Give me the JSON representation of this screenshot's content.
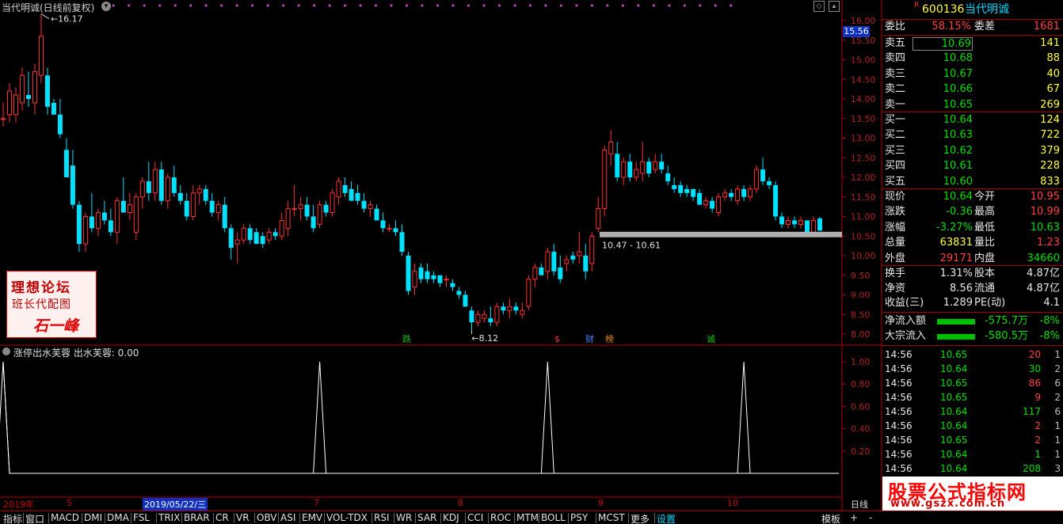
{
  "header": {
    "title": "当代明诚(日线前复权)",
    "cursor_price": "15.56",
    "high_label": "16.17",
    "low_label": "8.12",
    "band_label": "10.47 - 10.61"
  },
  "y_ticks": [
    "16.00",
    "15.50",
    "15.00",
    "14.50",
    "14.00",
    "13.50",
    "13.00",
    "12.50",
    "12.00",
    "11.50",
    "11.00",
    "10.50",
    "10.00",
    "9.50",
    "9.00",
    "8.50",
    "8.00"
  ],
  "sub_ticks": [
    "1.00",
    "0.80",
    "0.60",
    "0.40",
    "0.20"
  ],
  "events": [
    {
      "label": "跌",
      "color": "#00c000"
    },
    {
      "label": "$",
      "color": "#ff3030"
    },
    {
      "label": "财",
      "color": "#4080ff"
    },
    {
      "label": "榜",
      "color": "#e08000"
    },
    {
      "label": "诚",
      "color": "#00c000"
    }
  ],
  "stamp": {
    "line1": "理想论坛",
    "line2": "班长代配图",
    "line3": "石一峰"
  },
  "indicator": {
    "title": "涨停出水芙蓉  出水芙蓉: 0.00"
  },
  "x_dates": {
    "year": "2019年",
    "m5": "5",
    "highlight": "2019/05/22/三",
    "m7": "7",
    "m8": "8",
    "m9": "9",
    "m10": "10",
    "period": "日线"
  },
  "chart_data": {
    "type": "candlestick",
    "title": "当代明诚(日线前复权)",
    "ylim": [
      7.8,
      16.2
    ],
    "candles": [
      {
        "o": 13.5,
        "h": 13.9,
        "l": 13.3,
        "c": 13.5
      },
      {
        "o": 13.6,
        "h": 14.4,
        "l": 13.4,
        "c": 14.2
      },
      {
        "o": 13.6,
        "h": 14.3,
        "l": 13.4,
        "c": 14.1
      },
      {
        "o": 13.9,
        "h": 14.8,
        "l": 13.7,
        "c": 14.6
      },
      {
        "o": 14.1,
        "h": 14.7,
        "l": 13.8,
        "c": 14.0
      },
      {
        "o": 13.9,
        "h": 14.9,
        "l": 13.6,
        "c": 14.7
      },
      {
        "o": 14.6,
        "h": 16.17,
        "l": 14.4,
        "c": 15.6
      },
      {
        "o": 14.6,
        "h": 14.8,
        "l": 13.6,
        "c": 13.8
      },
      {
        "o": 13.9,
        "h": 14.0,
        "l": 13.6,
        "c": 13.6
      },
      {
        "o": 13.6,
        "h": 14.0,
        "l": 13.0,
        "c": 13.1
      },
      {
        "o": 12.7,
        "h": 13.0,
        "l": 12.0,
        "c": 12.0
      },
      {
        "o": 12.3,
        "h": 12.7,
        "l": 11.2,
        "c": 11.3
      },
      {
        "o": 11.3,
        "h": 11.4,
        "l": 10.1,
        "c": 10.3
      },
      {
        "o": 10.3,
        "h": 11.1,
        "l": 10.1,
        "c": 11.0
      },
      {
        "o": 11.0,
        "h": 11.6,
        "l": 10.6,
        "c": 10.7
      },
      {
        "o": 10.7,
        "h": 11.2,
        "l": 10.5,
        "c": 11.1
      },
      {
        "o": 11.1,
        "h": 11.4,
        "l": 10.8,
        "c": 10.9
      },
      {
        "o": 10.9,
        "h": 11.2,
        "l": 10.5,
        "c": 10.6
      },
      {
        "o": 10.6,
        "h": 11.5,
        "l": 10.3,
        "c": 11.4
      },
      {
        "o": 11.4,
        "h": 12.0,
        "l": 11.1,
        "c": 11.1
      },
      {
        "o": 11.1,
        "h": 11.6,
        "l": 10.9,
        "c": 11.3
      },
      {
        "o": 10.6,
        "h": 11.6,
        "l": 10.4,
        "c": 11.5
      },
      {
        "o": 11.5,
        "h": 12.0,
        "l": 11.2,
        "c": 11.9
      },
      {
        "o": 11.9,
        "h": 12.4,
        "l": 11.4,
        "c": 11.6
      },
      {
        "o": 11.6,
        "h": 12.4,
        "l": 11.4,
        "c": 12.2
      },
      {
        "o": 12.2,
        "h": 12.4,
        "l": 11.3,
        "c": 11.4
      },
      {
        "o": 11.4,
        "h": 12.1,
        "l": 11.2,
        "c": 12.0
      },
      {
        "o": 12.0,
        "h": 12.3,
        "l": 11.5,
        "c": 11.6
      },
      {
        "o": 11.6,
        "h": 11.8,
        "l": 11.3,
        "c": 11.4
      },
      {
        "o": 11.4,
        "h": 11.6,
        "l": 10.9,
        "c": 11.0
      },
      {
        "o": 11.0,
        "h": 11.8,
        "l": 10.9,
        "c": 11.6
      },
      {
        "o": 11.6,
        "h": 11.8,
        "l": 11.3,
        "c": 11.7
      },
      {
        "o": 11.7,
        "h": 11.8,
        "l": 11.3,
        "c": 11.4
      },
      {
        "o": 11.4,
        "h": 11.6,
        "l": 11.0,
        "c": 11.1
      },
      {
        "o": 11.1,
        "h": 11.4,
        "l": 10.9,
        "c": 11.3
      },
      {
        "o": 11.3,
        "h": 11.5,
        "l": 10.6,
        "c": 10.7
      },
      {
        "o": 10.7,
        "h": 10.8,
        "l": 9.9,
        "c": 10.2
      },
      {
        "o": 10.3,
        "h": 10.6,
        "l": 9.8,
        "c": 10.4
      },
      {
        "o": 10.4,
        "h": 10.8,
        "l": 10.3,
        "c": 10.7
      },
      {
        "o": 10.7,
        "h": 10.8,
        "l": 10.3,
        "c": 10.4
      },
      {
        "o": 10.6,
        "h": 10.7,
        "l": 10.3,
        "c": 10.3
      },
      {
        "o": 10.5,
        "h": 10.6,
        "l": 10.2,
        "c": 10.3
      },
      {
        "o": 10.4,
        "h": 10.7,
        "l": 10.3,
        "c": 10.6
      },
      {
        "o": 10.6,
        "h": 10.7,
        "l": 10.4,
        "c": 10.5
      },
      {
        "o": 10.5,
        "h": 11.1,
        "l": 10.4,
        "c": 10.9
      },
      {
        "o": 10.7,
        "h": 11.4,
        "l": 10.5,
        "c": 11.2
      },
      {
        "o": 11.2,
        "h": 11.8,
        "l": 11.0,
        "c": 11.2
      },
      {
        "o": 11.2,
        "h": 11.5,
        "l": 10.9,
        "c": 11.3
      },
      {
        "o": 11.3,
        "h": 11.5,
        "l": 10.9,
        "c": 11.0
      },
      {
        "o": 11.0,
        "h": 11.3,
        "l": 10.6,
        "c": 10.7
      },
      {
        "o": 10.8,
        "h": 11.4,
        "l": 10.7,
        "c": 11.3
      },
      {
        "o": 11.3,
        "h": 11.4,
        "l": 11.0,
        "c": 11.1
      },
      {
        "o": 11.1,
        "h": 11.7,
        "l": 11.0,
        "c": 11.6
      },
      {
        "o": 11.5,
        "h": 12.0,
        "l": 11.3,
        "c": 11.9
      },
      {
        "o": 11.8,
        "h": 12.0,
        "l": 11.5,
        "c": 11.6
      },
      {
        "o": 11.7,
        "h": 11.9,
        "l": 11.4,
        "c": 11.4
      },
      {
        "o": 11.6,
        "h": 11.8,
        "l": 11.3,
        "c": 11.4
      },
      {
        "o": 11.4,
        "h": 11.6,
        "l": 11.1,
        "c": 11.2
      },
      {
        "o": 11.2,
        "h": 11.4,
        "l": 11.0,
        "c": 11.3
      },
      {
        "o": 11.2,
        "h": 11.3,
        "l": 10.9,
        "c": 10.9
      },
      {
        "o": 10.9,
        "h": 11.1,
        "l": 10.6,
        "c": 10.7
      },
      {
        "o": 10.7,
        "h": 10.8,
        "l": 10.6,
        "c": 10.7
      },
      {
        "o": 10.7,
        "h": 10.9,
        "l": 10.5,
        "c": 10.6
      },
      {
        "o": 10.6,
        "h": 10.8,
        "l": 10.0,
        "c": 10.1
      },
      {
        "o": 10.0,
        "h": 10.1,
        "l": 9.0,
        "c": 9.1
      },
      {
        "o": 9.2,
        "h": 9.8,
        "l": 9.0,
        "c": 9.6
      },
      {
        "o": 9.7,
        "h": 9.8,
        "l": 9.3,
        "c": 9.4
      },
      {
        "o": 9.6,
        "h": 9.8,
        "l": 9.3,
        "c": 9.4
      },
      {
        "o": 9.5,
        "h": 9.6,
        "l": 9.3,
        "c": 9.4
      },
      {
        "o": 9.5,
        "h": 9.5,
        "l": 9.2,
        "c": 9.3
      },
      {
        "o": 9.4,
        "h": 9.5,
        "l": 9.2,
        "c": 9.4
      },
      {
        "o": 9.3,
        "h": 9.4,
        "l": 9.1,
        "c": 9.2
      },
      {
        "o": 9.1,
        "h": 9.2,
        "l": 8.9,
        "c": 9.0
      },
      {
        "o": 9.0,
        "h": 9.1,
        "l": 8.7,
        "c": 8.7
      },
      {
        "o": 8.6,
        "h": 8.7,
        "l": 8.12,
        "c": 8.3
      },
      {
        "o": 8.3,
        "h": 8.6,
        "l": 8.2,
        "c": 8.5
      },
      {
        "o": 8.4,
        "h": 8.6,
        "l": 8.3,
        "c": 8.5
      },
      {
        "o": 8.4,
        "h": 8.7,
        "l": 8.2,
        "c": 8.3
      },
      {
        "o": 8.3,
        "h": 8.8,
        "l": 8.2,
        "c": 8.7
      },
      {
        "o": 8.7,
        "h": 8.8,
        "l": 8.5,
        "c": 8.6
      },
      {
        "o": 8.6,
        "h": 8.9,
        "l": 8.4,
        "c": 8.7
      },
      {
        "o": 8.7,
        "h": 8.8,
        "l": 8.5,
        "c": 8.6
      },
      {
        "o": 8.5,
        "h": 8.8,
        "l": 8.4,
        "c": 8.6
      },
      {
        "o": 8.7,
        "h": 9.5,
        "l": 8.6,
        "c": 9.4
      },
      {
        "o": 9.4,
        "h": 9.8,
        "l": 9.2,
        "c": 9.7
      },
      {
        "o": 9.7,
        "h": 9.8,
        "l": 9.5,
        "c": 9.5
      },
      {
        "o": 9.6,
        "h": 10.2,
        "l": 9.4,
        "c": 10.1
      },
      {
        "o": 10.1,
        "h": 10.3,
        "l": 9.5,
        "c": 9.6
      },
      {
        "o": 9.7,
        "h": 10.0,
        "l": 9.3,
        "c": 9.4
      },
      {
        "o": 9.8,
        "h": 10.0,
        "l": 9.6,
        "c": 9.9
      },
      {
        "o": 10.0,
        "h": 10.1,
        "l": 9.8,
        "c": 9.9
      },
      {
        "o": 10.0,
        "h": 10.6,
        "l": 9.8,
        "c": 10.1
      },
      {
        "o": 10.0,
        "h": 10.3,
        "l": 9.4,
        "c": 9.6
      },
      {
        "o": 9.8,
        "h": 10.6,
        "l": 9.6,
        "c": 10.5
      },
      {
        "o": 10.7,
        "h": 11.5,
        "l": 10.6,
        "c": 11.2
      },
      {
        "o": 11.2,
        "h": 12.8,
        "l": 11.0,
        "c": 12.7
      },
      {
        "o": 12.6,
        "h": 13.2,
        "l": 12.3,
        "c": 12.9
      },
      {
        "o": 12.6,
        "h": 12.9,
        "l": 11.9,
        "c": 12.0
      },
      {
        "o": 12.0,
        "h": 12.5,
        "l": 11.8,
        "c": 12.4
      },
      {
        "o": 12.4,
        "h": 12.6,
        "l": 11.9,
        "c": 12.0
      },
      {
        "o": 12.0,
        "h": 12.4,
        "l": 11.9,
        "c": 12.2
      },
      {
        "o": 12.1,
        "h": 12.9,
        "l": 11.9,
        "c": 12.4
      },
      {
        "o": 12.4,
        "h": 12.5,
        "l": 12.0,
        "c": 12.1
      },
      {
        "o": 12.2,
        "h": 12.6,
        "l": 12.1,
        "c": 12.4
      },
      {
        "o": 12.4,
        "h": 12.6,
        "l": 12.1,
        "c": 12.2
      },
      {
        "o": 12.1,
        "h": 12.3,
        "l": 11.8,
        "c": 11.9
      },
      {
        "o": 11.8,
        "h": 12.0,
        "l": 11.6,
        "c": 11.7
      },
      {
        "o": 11.8,
        "h": 11.9,
        "l": 11.5,
        "c": 11.6
      },
      {
        "o": 11.7,
        "h": 11.8,
        "l": 11.5,
        "c": 11.6
      },
      {
        "o": 11.7,
        "h": 11.7,
        "l": 11.4,
        "c": 11.5
      },
      {
        "o": 11.6,
        "h": 11.7,
        "l": 11.3,
        "c": 11.3
      },
      {
        "o": 11.3,
        "h": 11.5,
        "l": 11.2,
        "c": 11.4
      },
      {
        "o": 11.4,
        "h": 11.5,
        "l": 11.1,
        "c": 11.2
      },
      {
        "o": 11.1,
        "h": 11.6,
        "l": 11.0,
        "c": 11.5
      },
      {
        "o": 11.5,
        "h": 11.7,
        "l": 11.4,
        "c": 11.6
      },
      {
        "o": 11.6,
        "h": 11.7,
        "l": 11.4,
        "c": 11.5
      },
      {
        "o": 11.4,
        "h": 11.8,
        "l": 11.3,
        "c": 11.7
      },
      {
        "o": 11.7,
        "h": 11.8,
        "l": 11.4,
        "c": 11.5
      },
      {
        "o": 11.5,
        "h": 11.8,
        "l": 11.4,
        "c": 11.7
      },
      {
        "o": 11.7,
        "h": 12.3,
        "l": 11.6,
        "c": 12.2
      },
      {
        "o": 12.2,
        "h": 12.5,
        "l": 11.8,
        "c": 11.9
      },
      {
        "o": 11.9,
        "h": 12.0,
        "l": 11.7,
        "c": 11.8
      },
      {
        "o": 11.8,
        "h": 11.9,
        "l": 10.9,
        "c": 11.0
      },
      {
        "o": 11.0,
        "h": 11.1,
        "l": 10.7,
        "c": 10.8
      },
      {
        "o": 10.8,
        "h": 11.0,
        "l": 10.7,
        "c": 10.9
      },
      {
        "o": 10.9,
        "h": 11.0,
        "l": 10.7,
        "c": 10.8
      },
      {
        "o": 10.8,
        "h": 11.0,
        "l": 10.7,
        "c": 10.9
      },
      {
        "o": 10.9,
        "h": 10.9,
        "l": 10.6,
        "c": 10.6
      },
      {
        "o": 10.6,
        "h": 11.0,
        "l": 10.6,
        "c": 10.9
      },
      {
        "o": 10.95,
        "h": 10.99,
        "l": 10.63,
        "c": 10.64
      }
    ],
    "sub_series": [
      1,
      0,
      0,
      0,
      0,
      0,
      0,
      0,
      0,
      0,
      0,
      0,
      0,
      0,
      0,
      0,
      0,
      0,
      0,
      0,
      0,
      0,
      0,
      0,
      0,
      0,
      0,
      0,
      0,
      0,
      0,
      0,
      0,
      0,
      0,
      0,
      0,
      0,
      0,
      0,
      0,
      0,
      0,
      0,
      0,
      0,
      0,
      0,
      0,
      0,
      0,
      0,
      0,
      0,
      0,
      0,
      0,
      0,
      0,
      0,
      0,
      0,
      0,
      0,
      0,
      0,
      0,
      0,
      0,
      0,
      0,
      0,
      0,
      0,
      0,
      0,
      0,
      0,
      0,
      0,
      0,
      0,
      0,
      0,
      0,
      0,
      0,
      0,
      0,
      0,
      0,
      0,
      0,
      0,
      0,
      0,
      0,
      0,
      0,
      0,
      0,
      0,
      0,
      0,
      0,
      0,
      0,
      0,
      0,
      0,
      0,
      0,
      0,
      0,
      0,
      0,
      0,
      0,
      0,
      0,
      0,
      0,
      0,
      0,
      0,
      0,
      0,
      0,
      0,
      0,
      0,
      0,
      0
    ],
    "sub_peaks": [
      0,
      50,
      86,
      117
    ]
  },
  "quote": {
    "flag": "R",
    "code": "600136",
    "name": "当代明诚",
    "weibi_label": "委比",
    "weibi_val": "58.15%",
    "weicha_label": "委差",
    "weicha_val": "1681",
    "asks": [
      {
        "label": "卖五",
        "price": "10.69",
        "vol": "141"
      },
      {
        "label": "卖四",
        "price": "10.68",
        "vol": "88"
      },
      {
        "label": "卖三",
        "price": "10.67",
        "vol": "40"
      },
      {
        "label": "卖二",
        "price": "10.66",
        "vol": "67"
      },
      {
        "label": "卖一",
        "price": "10.65",
        "vol": "269"
      }
    ],
    "bids": [
      {
        "label": "买一",
        "price": "10.64",
        "vol": "124"
      },
      {
        "label": "买二",
        "price": "10.63",
        "vol": "722"
      },
      {
        "label": "买三",
        "price": "10.62",
        "vol": "379"
      },
      {
        "label": "买四",
        "price": "10.61",
        "vol": "228"
      },
      {
        "label": "买五",
        "price": "10.60",
        "vol": "833"
      }
    ],
    "stats": [
      {
        "l1": "现价",
        "v1": "10.64",
        "c1": "grn",
        "l2": "今开",
        "v2": "10.95",
        "c2": "red"
      },
      {
        "l1": "涨跌",
        "v1": "-0.36",
        "c1": "grn",
        "l2": "最高",
        "v2": "10.99",
        "c2": "red"
      },
      {
        "l1": "涨幅",
        "v1": "-3.27%",
        "c1": "grn",
        "l2": "最低",
        "v2": "10.63",
        "c2": "grn"
      },
      {
        "l1": "总量",
        "v1": "63831",
        "c1": "yel",
        "l2": "量比",
        "v2": "1.23",
        "c2": "red"
      },
      {
        "l1": "外盘",
        "v1": "29171",
        "c1": "red",
        "l2": "内盘",
        "v2": "34660",
        "c2": "grn"
      }
    ],
    "fund": [
      {
        "l1": "换手",
        "v1": "1.31%",
        "l2": "股本",
        "v2": "4.87亿"
      },
      {
        "l1": "净资",
        "v1": "8.56",
        "l2": "流通",
        "v2": "4.87亿"
      },
      {
        "l1": "收益(三)",
        "v1": "1.289",
        "l2": "PE(动)",
        "v2": "4.1"
      }
    ],
    "flows": [
      {
        "label": "净流入额",
        "val": "-575.7万",
        "pct": "-8%"
      },
      {
        "label": "大宗流入",
        "val": "-580.5万",
        "pct": "-8%"
      }
    ],
    "ticks": [
      {
        "t": "14:56",
        "p": "10.65",
        "v": "20",
        "vc": "red",
        "n": "1"
      },
      {
        "t": "14:56",
        "p": "10.64",
        "v": "30",
        "vc": "grn",
        "n": "2"
      },
      {
        "t": "14:56",
        "p": "10.65",
        "v": "86",
        "vc": "red",
        "n": "6"
      },
      {
        "t": "14:56",
        "p": "10.65",
        "v": "9",
        "vc": "red",
        "n": "2"
      },
      {
        "t": "14:56",
        "p": "10.64",
        "v": "117",
        "vc": "grn",
        "n": "6"
      },
      {
        "t": "14:56",
        "p": "10.64",
        "v": "2",
        "vc": "red",
        "n": "1"
      },
      {
        "t": "14:56",
        "p": "10.65",
        "v": "2",
        "vc": "red",
        "n": "1"
      },
      {
        "t": "14:56",
        "p": "10.64",
        "v": "1",
        "vc": "grn",
        "n": "1"
      },
      {
        "t": "14:56",
        "p": "10.64",
        "v": "208",
        "vc": "grn",
        "n": "3"
      }
    ]
  },
  "watermark": {
    "line1": "股票公式指标网",
    "line2": "www.gszx.com.cn"
  },
  "tabs": [
    "指标",
    "窗口",
    "MACD",
    "DMI",
    "DMA",
    "FSL",
    "TRIX",
    "BRAR",
    "CR",
    "VR",
    "OBV",
    "ASI",
    "EMV",
    "VOL-TDX",
    "RSI",
    "WR",
    "SAR",
    "KDJ",
    "CCI",
    "ROC",
    "MTM",
    "BOLL",
    "PSY",
    "MCST",
    "更多",
    "设置"
  ],
  "bottom_right": {
    "template": "模板",
    "plus": "+",
    "minus": "-"
  }
}
